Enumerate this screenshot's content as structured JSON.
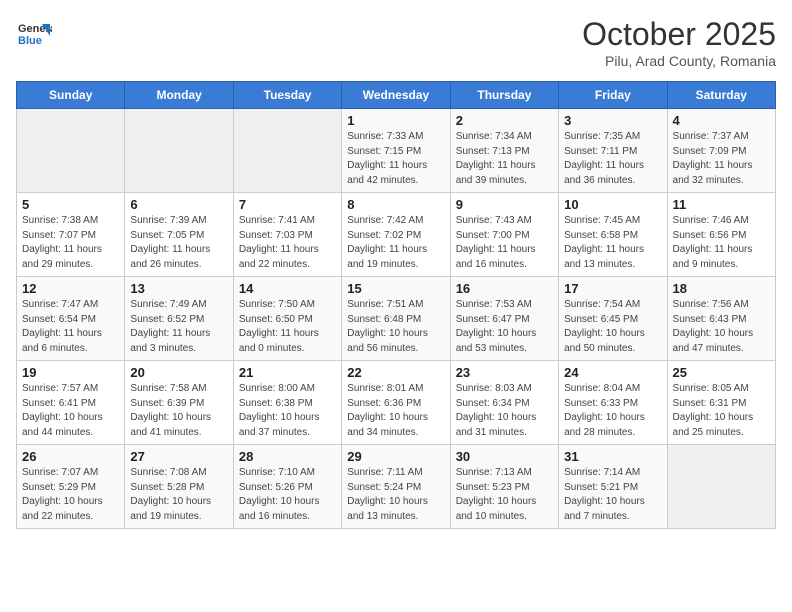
{
  "header": {
    "logo_line1": "General",
    "logo_line2": "Blue",
    "month": "October 2025",
    "location": "Pilu, Arad County, Romania"
  },
  "days_of_week": [
    "Sunday",
    "Monday",
    "Tuesday",
    "Wednesday",
    "Thursday",
    "Friday",
    "Saturday"
  ],
  "weeks": [
    [
      {
        "day": "",
        "info": ""
      },
      {
        "day": "",
        "info": ""
      },
      {
        "day": "",
        "info": ""
      },
      {
        "day": "1",
        "info": "Sunrise: 7:33 AM\nSunset: 7:15 PM\nDaylight: 11 hours and 42 minutes."
      },
      {
        "day": "2",
        "info": "Sunrise: 7:34 AM\nSunset: 7:13 PM\nDaylight: 11 hours and 39 minutes."
      },
      {
        "day": "3",
        "info": "Sunrise: 7:35 AM\nSunset: 7:11 PM\nDaylight: 11 hours and 36 minutes."
      },
      {
        "day": "4",
        "info": "Sunrise: 7:37 AM\nSunset: 7:09 PM\nDaylight: 11 hours and 32 minutes."
      }
    ],
    [
      {
        "day": "5",
        "info": "Sunrise: 7:38 AM\nSunset: 7:07 PM\nDaylight: 11 hours and 29 minutes."
      },
      {
        "day": "6",
        "info": "Sunrise: 7:39 AM\nSunset: 7:05 PM\nDaylight: 11 hours and 26 minutes."
      },
      {
        "day": "7",
        "info": "Sunrise: 7:41 AM\nSunset: 7:03 PM\nDaylight: 11 hours and 22 minutes."
      },
      {
        "day": "8",
        "info": "Sunrise: 7:42 AM\nSunset: 7:02 PM\nDaylight: 11 hours and 19 minutes."
      },
      {
        "day": "9",
        "info": "Sunrise: 7:43 AM\nSunset: 7:00 PM\nDaylight: 11 hours and 16 minutes."
      },
      {
        "day": "10",
        "info": "Sunrise: 7:45 AM\nSunset: 6:58 PM\nDaylight: 11 hours and 13 minutes."
      },
      {
        "day": "11",
        "info": "Sunrise: 7:46 AM\nSunset: 6:56 PM\nDaylight: 11 hours and 9 minutes."
      }
    ],
    [
      {
        "day": "12",
        "info": "Sunrise: 7:47 AM\nSunset: 6:54 PM\nDaylight: 11 hours and 6 minutes."
      },
      {
        "day": "13",
        "info": "Sunrise: 7:49 AM\nSunset: 6:52 PM\nDaylight: 11 hours and 3 minutes."
      },
      {
        "day": "14",
        "info": "Sunrise: 7:50 AM\nSunset: 6:50 PM\nDaylight: 11 hours and 0 minutes."
      },
      {
        "day": "15",
        "info": "Sunrise: 7:51 AM\nSunset: 6:48 PM\nDaylight: 10 hours and 56 minutes."
      },
      {
        "day": "16",
        "info": "Sunrise: 7:53 AM\nSunset: 6:47 PM\nDaylight: 10 hours and 53 minutes."
      },
      {
        "day": "17",
        "info": "Sunrise: 7:54 AM\nSunset: 6:45 PM\nDaylight: 10 hours and 50 minutes."
      },
      {
        "day": "18",
        "info": "Sunrise: 7:56 AM\nSunset: 6:43 PM\nDaylight: 10 hours and 47 minutes."
      }
    ],
    [
      {
        "day": "19",
        "info": "Sunrise: 7:57 AM\nSunset: 6:41 PM\nDaylight: 10 hours and 44 minutes."
      },
      {
        "day": "20",
        "info": "Sunrise: 7:58 AM\nSunset: 6:39 PM\nDaylight: 10 hours and 41 minutes."
      },
      {
        "day": "21",
        "info": "Sunrise: 8:00 AM\nSunset: 6:38 PM\nDaylight: 10 hours and 37 minutes."
      },
      {
        "day": "22",
        "info": "Sunrise: 8:01 AM\nSunset: 6:36 PM\nDaylight: 10 hours and 34 minutes."
      },
      {
        "day": "23",
        "info": "Sunrise: 8:03 AM\nSunset: 6:34 PM\nDaylight: 10 hours and 31 minutes."
      },
      {
        "day": "24",
        "info": "Sunrise: 8:04 AM\nSunset: 6:33 PM\nDaylight: 10 hours and 28 minutes."
      },
      {
        "day": "25",
        "info": "Sunrise: 8:05 AM\nSunset: 6:31 PM\nDaylight: 10 hours and 25 minutes."
      }
    ],
    [
      {
        "day": "26",
        "info": "Sunrise: 7:07 AM\nSunset: 5:29 PM\nDaylight: 10 hours and 22 minutes."
      },
      {
        "day": "27",
        "info": "Sunrise: 7:08 AM\nSunset: 5:28 PM\nDaylight: 10 hours and 19 minutes."
      },
      {
        "day": "28",
        "info": "Sunrise: 7:10 AM\nSunset: 5:26 PM\nDaylight: 10 hours and 16 minutes."
      },
      {
        "day": "29",
        "info": "Sunrise: 7:11 AM\nSunset: 5:24 PM\nDaylight: 10 hours and 13 minutes."
      },
      {
        "day": "30",
        "info": "Sunrise: 7:13 AM\nSunset: 5:23 PM\nDaylight: 10 hours and 10 minutes."
      },
      {
        "day": "31",
        "info": "Sunrise: 7:14 AM\nSunset: 5:21 PM\nDaylight: 10 hours and 7 minutes."
      },
      {
        "day": "",
        "info": ""
      }
    ]
  ]
}
